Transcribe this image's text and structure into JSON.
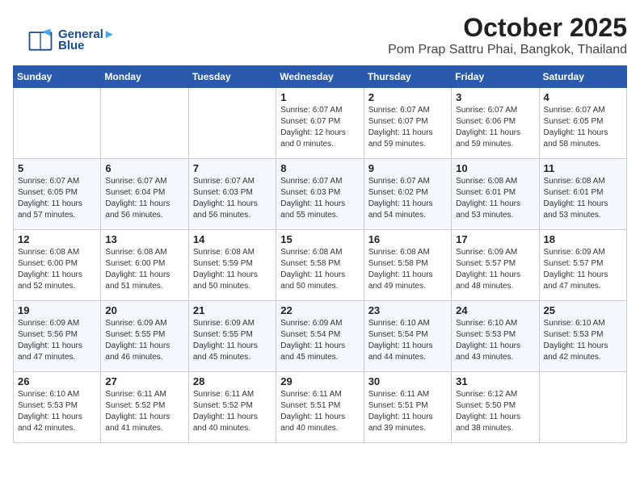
{
  "logo": {
    "line1": "General",
    "line2": "Blue"
  },
  "header": {
    "month": "October 2025",
    "location": "Pom Prap Sattru Phai, Bangkok, Thailand"
  },
  "weekdays": [
    "Sunday",
    "Monday",
    "Tuesday",
    "Wednesday",
    "Thursday",
    "Friday",
    "Saturday"
  ],
  "weeks": [
    [
      {
        "day": "",
        "info": ""
      },
      {
        "day": "",
        "info": ""
      },
      {
        "day": "",
        "info": ""
      },
      {
        "day": "1",
        "info": "Sunrise: 6:07 AM\nSunset: 6:07 PM\nDaylight: 12 hours\nand 0 minutes."
      },
      {
        "day": "2",
        "info": "Sunrise: 6:07 AM\nSunset: 6:07 PM\nDaylight: 11 hours\nand 59 minutes."
      },
      {
        "day": "3",
        "info": "Sunrise: 6:07 AM\nSunset: 6:06 PM\nDaylight: 11 hours\nand 59 minutes."
      },
      {
        "day": "4",
        "info": "Sunrise: 6:07 AM\nSunset: 6:05 PM\nDaylight: 11 hours\nand 58 minutes."
      }
    ],
    [
      {
        "day": "5",
        "info": "Sunrise: 6:07 AM\nSunset: 6:05 PM\nDaylight: 11 hours\nand 57 minutes."
      },
      {
        "day": "6",
        "info": "Sunrise: 6:07 AM\nSunset: 6:04 PM\nDaylight: 11 hours\nand 56 minutes."
      },
      {
        "day": "7",
        "info": "Sunrise: 6:07 AM\nSunset: 6:03 PM\nDaylight: 11 hours\nand 56 minutes."
      },
      {
        "day": "8",
        "info": "Sunrise: 6:07 AM\nSunset: 6:03 PM\nDaylight: 11 hours\nand 55 minutes."
      },
      {
        "day": "9",
        "info": "Sunrise: 6:07 AM\nSunset: 6:02 PM\nDaylight: 11 hours\nand 54 minutes."
      },
      {
        "day": "10",
        "info": "Sunrise: 6:08 AM\nSunset: 6:01 PM\nDaylight: 11 hours\nand 53 minutes."
      },
      {
        "day": "11",
        "info": "Sunrise: 6:08 AM\nSunset: 6:01 PM\nDaylight: 11 hours\nand 53 minutes."
      }
    ],
    [
      {
        "day": "12",
        "info": "Sunrise: 6:08 AM\nSunset: 6:00 PM\nDaylight: 11 hours\nand 52 minutes."
      },
      {
        "day": "13",
        "info": "Sunrise: 6:08 AM\nSunset: 6:00 PM\nDaylight: 11 hours\nand 51 minutes."
      },
      {
        "day": "14",
        "info": "Sunrise: 6:08 AM\nSunset: 5:59 PM\nDaylight: 11 hours\nand 50 minutes."
      },
      {
        "day": "15",
        "info": "Sunrise: 6:08 AM\nSunset: 5:58 PM\nDaylight: 11 hours\nand 50 minutes."
      },
      {
        "day": "16",
        "info": "Sunrise: 6:08 AM\nSunset: 5:58 PM\nDaylight: 11 hours\nand 49 minutes."
      },
      {
        "day": "17",
        "info": "Sunrise: 6:09 AM\nSunset: 5:57 PM\nDaylight: 11 hours\nand 48 minutes."
      },
      {
        "day": "18",
        "info": "Sunrise: 6:09 AM\nSunset: 5:57 PM\nDaylight: 11 hours\nand 47 minutes."
      }
    ],
    [
      {
        "day": "19",
        "info": "Sunrise: 6:09 AM\nSunset: 5:56 PM\nDaylight: 11 hours\nand 47 minutes."
      },
      {
        "day": "20",
        "info": "Sunrise: 6:09 AM\nSunset: 5:55 PM\nDaylight: 11 hours\nand 46 minutes."
      },
      {
        "day": "21",
        "info": "Sunrise: 6:09 AM\nSunset: 5:55 PM\nDaylight: 11 hours\nand 45 minutes."
      },
      {
        "day": "22",
        "info": "Sunrise: 6:09 AM\nSunset: 5:54 PM\nDaylight: 11 hours\nand 45 minutes."
      },
      {
        "day": "23",
        "info": "Sunrise: 6:10 AM\nSunset: 5:54 PM\nDaylight: 11 hours\nand 44 minutes."
      },
      {
        "day": "24",
        "info": "Sunrise: 6:10 AM\nSunset: 5:53 PM\nDaylight: 11 hours\nand 43 minutes."
      },
      {
        "day": "25",
        "info": "Sunrise: 6:10 AM\nSunset: 5:53 PM\nDaylight: 11 hours\nand 42 minutes."
      }
    ],
    [
      {
        "day": "26",
        "info": "Sunrise: 6:10 AM\nSunset: 5:53 PM\nDaylight: 11 hours\nand 42 minutes."
      },
      {
        "day": "27",
        "info": "Sunrise: 6:11 AM\nSunset: 5:52 PM\nDaylight: 11 hours\nand 41 minutes."
      },
      {
        "day": "28",
        "info": "Sunrise: 6:11 AM\nSunset: 5:52 PM\nDaylight: 11 hours\nand 40 minutes."
      },
      {
        "day": "29",
        "info": "Sunrise: 6:11 AM\nSunset: 5:51 PM\nDaylight: 11 hours\nand 40 minutes."
      },
      {
        "day": "30",
        "info": "Sunrise: 6:11 AM\nSunset: 5:51 PM\nDaylight: 11 hours\nand 39 minutes."
      },
      {
        "day": "31",
        "info": "Sunrise: 6:12 AM\nSunset: 5:50 PM\nDaylight: 11 hours\nand 38 minutes."
      },
      {
        "day": "",
        "info": ""
      }
    ]
  ]
}
